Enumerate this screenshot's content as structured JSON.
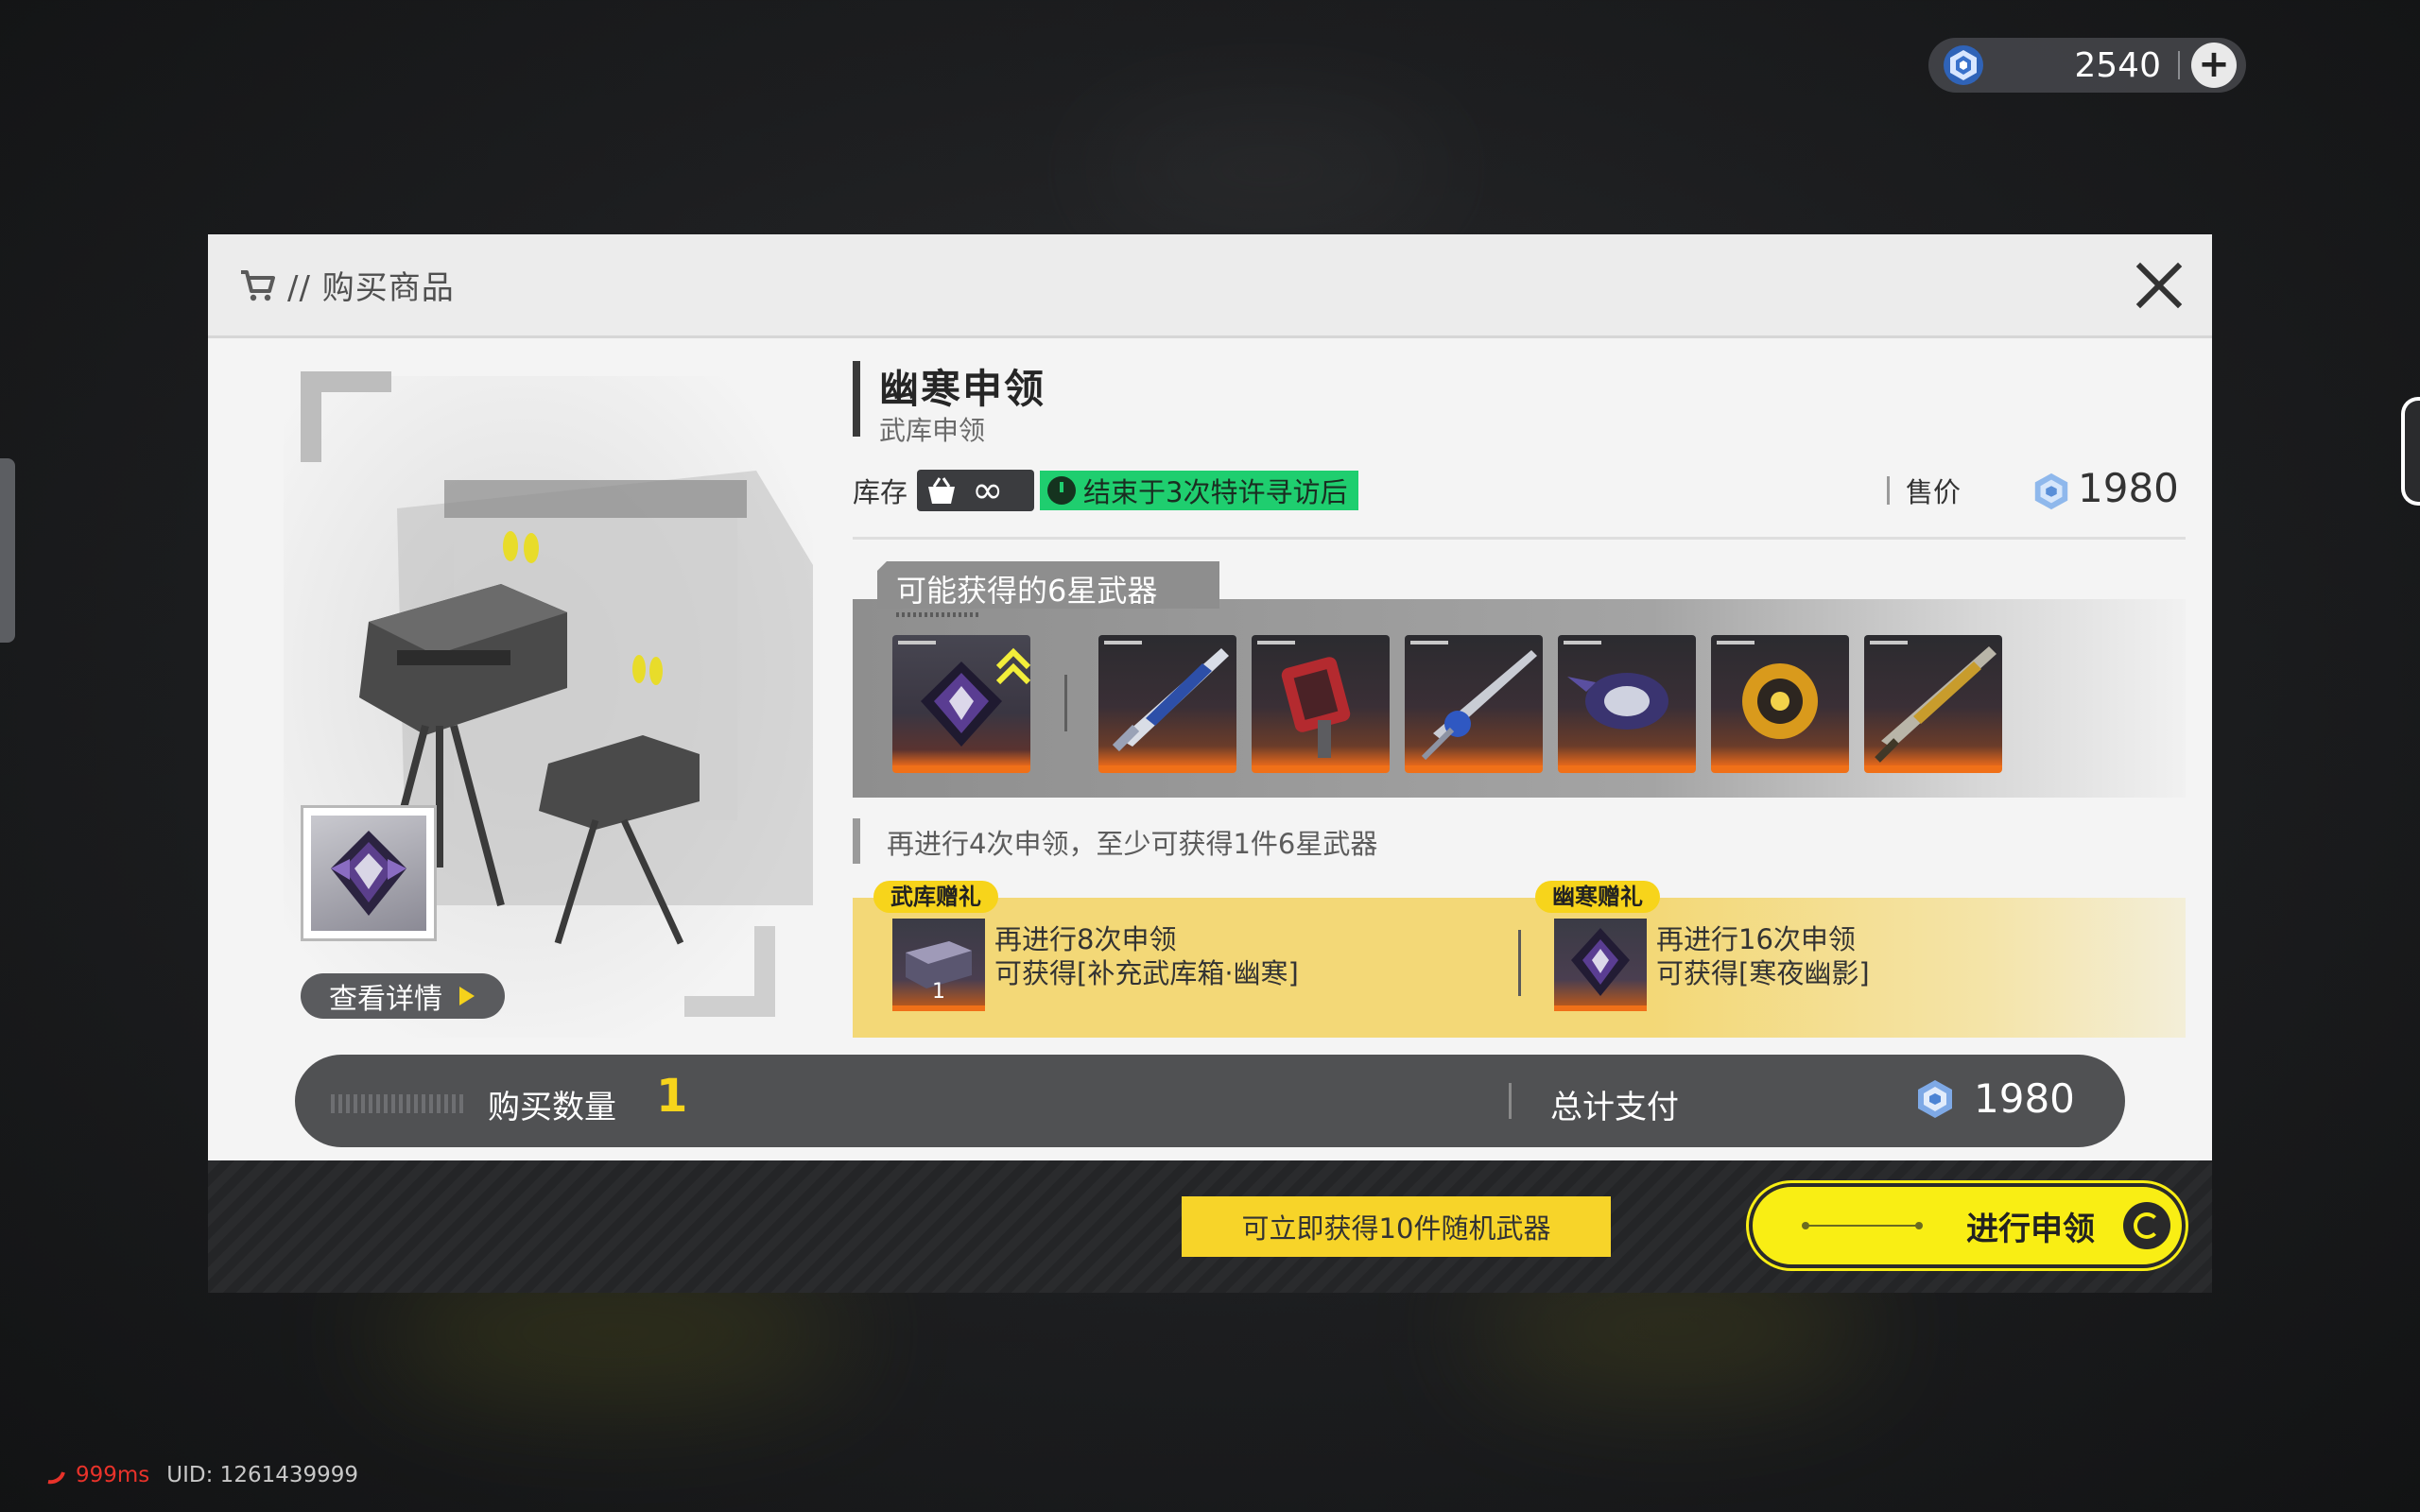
{
  "currency": {
    "amount": "2540",
    "icon": "crystal-currency-icon",
    "add_label": "+"
  },
  "dialog": {
    "title": "// 购买商品",
    "close_icon": "close-icon"
  },
  "product": {
    "name": "幽寒申领",
    "subtitle": "武库申领",
    "stock_label": "库存",
    "stock_value": "∞",
    "limit_text": "结束于3次特许寻访后",
    "price_label": "售价",
    "price_value": "1980",
    "detail_button": "查看详情"
  },
  "weapons": {
    "title": "可能获得的6星武器",
    "items": [
      {
        "name": "featured-weapon",
        "icon": "dark-crystal-weapon-icon"
      },
      {
        "name": "weapon-greatsword-blue",
        "icon": "greatsword-icon"
      },
      {
        "name": "weapon-red-launcher",
        "icon": "launcher-icon"
      },
      {
        "name": "weapon-silver-lance",
        "icon": "lance-icon"
      },
      {
        "name": "weapon-dark-gauntlet",
        "icon": "gauntlet-icon"
      },
      {
        "name": "weapon-gold-core",
        "icon": "core-icon"
      },
      {
        "name": "weapon-gold-blade",
        "icon": "blade-icon"
      }
    ],
    "guarantee_text": "再进行4次申领，至少可获得1件6星武器"
  },
  "gifts": [
    {
      "tag": "武库赠礼",
      "line1": "再进行8次申领",
      "line2": "可获得[补充武库箱·幽寒]",
      "count": "1"
    },
    {
      "tag": "幽寒赠礼",
      "line1": "再进行16次申领",
      "line2": "可获得[寒夜幽影]"
    }
  ],
  "purchase": {
    "quantity_label": "购买数量",
    "quantity": "1",
    "total_label": "总计支付",
    "total_value": "1980"
  },
  "footer": {
    "bonus_button": "可立即获得10件随机武器",
    "draw_button": "进行申领"
  },
  "status": {
    "ping": "999ms",
    "uid": "UID: 1261439999"
  },
  "colors": {
    "accent_yellow": "#f7d41b",
    "limit_green": "#1fce6f",
    "rarity_orange": "#f07018"
  }
}
